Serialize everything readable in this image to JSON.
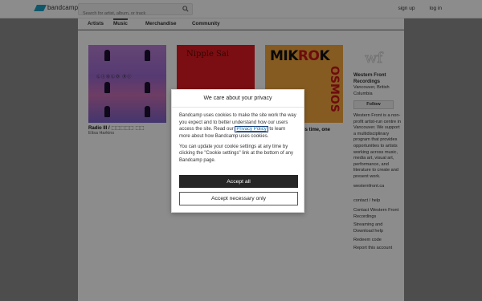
{
  "header": {
    "logo_text": "bandcamp",
    "search_placeholder": "Search for artist, album, or track",
    "signup_label": "sign up",
    "login_label": "log in"
  },
  "tabs": [
    {
      "label": "Artists"
    },
    {
      "label": "Music"
    },
    {
      "label": "Merchandise"
    },
    {
      "label": "Community"
    }
  ],
  "albums": [
    {
      "title": "Radio III / ⬚⬚⬚⬚⬚ ⬚⬚",
      "artist": "Elisa Harkins",
      "art_text": "ⓁⒾⓆⓁⓄ ⓇⒾ"
    },
    {
      "title": "",
      "artist": "",
      "art_text": "Nipple Sai"
    },
    {
      "title": "is time, one",
      "artist": "",
      "art_text": "MIKROKOSMOS"
    }
  ],
  "sidebar": {
    "logo_text": "wf",
    "name": "Western Front Recordings",
    "location": "Vancouver, British Columbia",
    "follow_label": "Follow",
    "description": "Western Front is a non-profit artist-run centre in Vancouver. We support a multidisciplinary program that provides opportunities to artists working across music, media art, visual art, performance, and literature to create and present work.",
    "website": "westernfront.ca",
    "links_heading": "contact / help",
    "links": [
      "Contact Western Front Recordings",
      "Streaming and Download help",
      "Redeem code",
      "Report this account"
    ]
  },
  "cookie_modal": {
    "title": "We care about your privacy",
    "para1_before": "Bandcamp uses cookies to make the site work the way you expect and to better understand how our users access the site. Read our ",
    "policy_link": "Privacy Policy",
    "para1_after": " to learn more about how Bandcamp uses cookies.",
    "para2": "You can update your cookie settings at any time by clicking the \"Cookie settings\" link at the bottom of any Bandcamp page.",
    "accept_all_label": "Accept all",
    "accept_necessary_label": "Accept necessary only"
  },
  "colors": {
    "logo_blue": "#1da0c3",
    "accept_bg": "#262626",
    "link": "#0a6aa1"
  }
}
